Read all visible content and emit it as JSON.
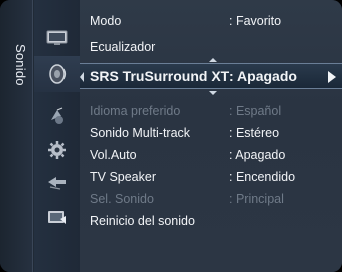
{
  "category": {
    "label": "Sonido"
  },
  "icons": [
    {
      "name": "picture-icon"
    },
    {
      "name": "sound-icon",
      "selected": true
    },
    {
      "name": "channel-icon"
    },
    {
      "name": "setup-icon"
    },
    {
      "name": "input-icon"
    },
    {
      "name": "application-icon"
    }
  ],
  "menu": {
    "items": [
      {
        "label": "Modo",
        "value": ": Favorito",
        "state": "normal"
      },
      {
        "label": "Ecualizador",
        "value": "",
        "state": "normal"
      },
      {
        "label": "SRS TruSurround XT",
        "value": ": Apagado",
        "state": "selected"
      },
      {
        "label": "Idioma preferido",
        "value": ": Español",
        "state": "disabled"
      },
      {
        "label": "Sonido Multi-track",
        "value": ": Estéreo",
        "state": "normal"
      },
      {
        "label": "Vol.Auto",
        "value": ": Apagado",
        "state": "normal"
      },
      {
        "label": "TV Speaker",
        "value": ": Encendido",
        "state": "normal"
      },
      {
        "label": "Sel. Sonido",
        "value": ": Principal",
        "state": "disabled"
      },
      {
        "label": "Reinicio del sonido",
        "value": "",
        "state": "normal"
      }
    ]
  }
}
